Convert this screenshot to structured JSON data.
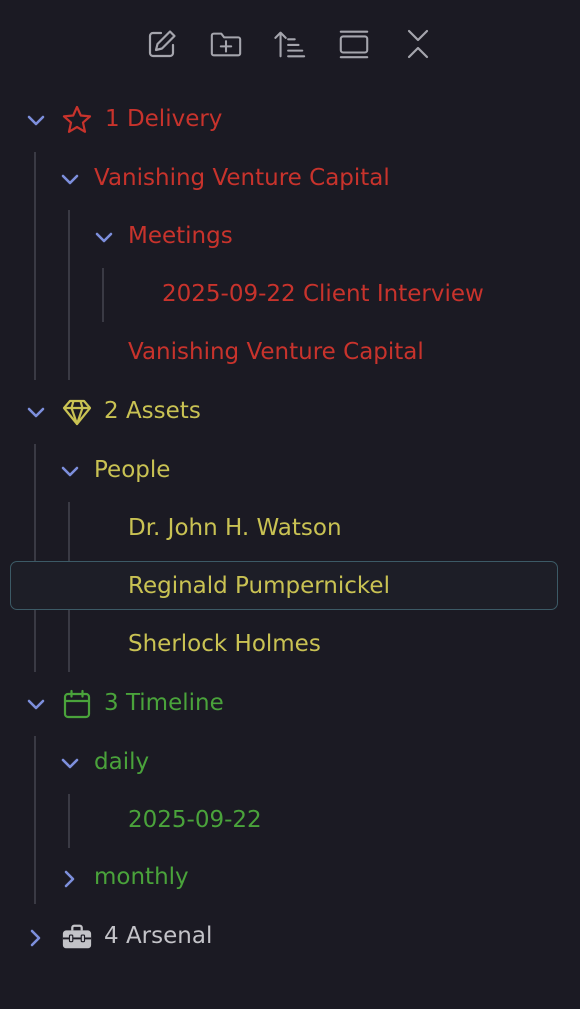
{
  "toolbar": {
    "buttons": [
      {
        "name": "new-note",
        "icon": "edit-icon"
      },
      {
        "name": "new-folder",
        "icon": "folder-plus-icon"
      },
      {
        "name": "sort",
        "icon": "sort-icon"
      },
      {
        "name": "auto-reveal",
        "icon": "reveal-icon"
      },
      {
        "name": "collapse-all",
        "icon": "collapse-all-icon"
      }
    ]
  },
  "colors": {
    "background": "#1b1a23",
    "chevron": "#7d8fdc",
    "delivery": "#c8332c",
    "assets": "#c9c253",
    "timeline": "#4aa33b",
    "arsenal": "#c3c3c8",
    "selection_border": "#3c5a66"
  },
  "tree": {
    "delivery": {
      "label": "1 Delivery",
      "icon": "star-icon",
      "expanded": true,
      "vvc_folder": "Vanishing Venture Capital",
      "meetings": "Meetings",
      "client_interview": "2025-09-22 Client Interview",
      "vvc_note": "Vanishing Venture Capital"
    },
    "assets": {
      "label": "2 Assets",
      "icon": "gem-icon",
      "expanded": true,
      "people": "People",
      "watson": "Dr. John H. Watson",
      "reginald": "Reginald Pumpernickel",
      "sherlock": "Sherlock Holmes"
    },
    "timeline": {
      "label": "3 Timeline",
      "icon": "calendar-icon",
      "expanded": true,
      "daily": "daily",
      "daily_note": "2025-09-22",
      "monthly": "monthly"
    },
    "arsenal": {
      "label": "4 Arsenal",
      "icon": "toolbox-icon",
      "expanded": false
    },
    "selected_item": "Reginald Pumpernickel"
  }
}
